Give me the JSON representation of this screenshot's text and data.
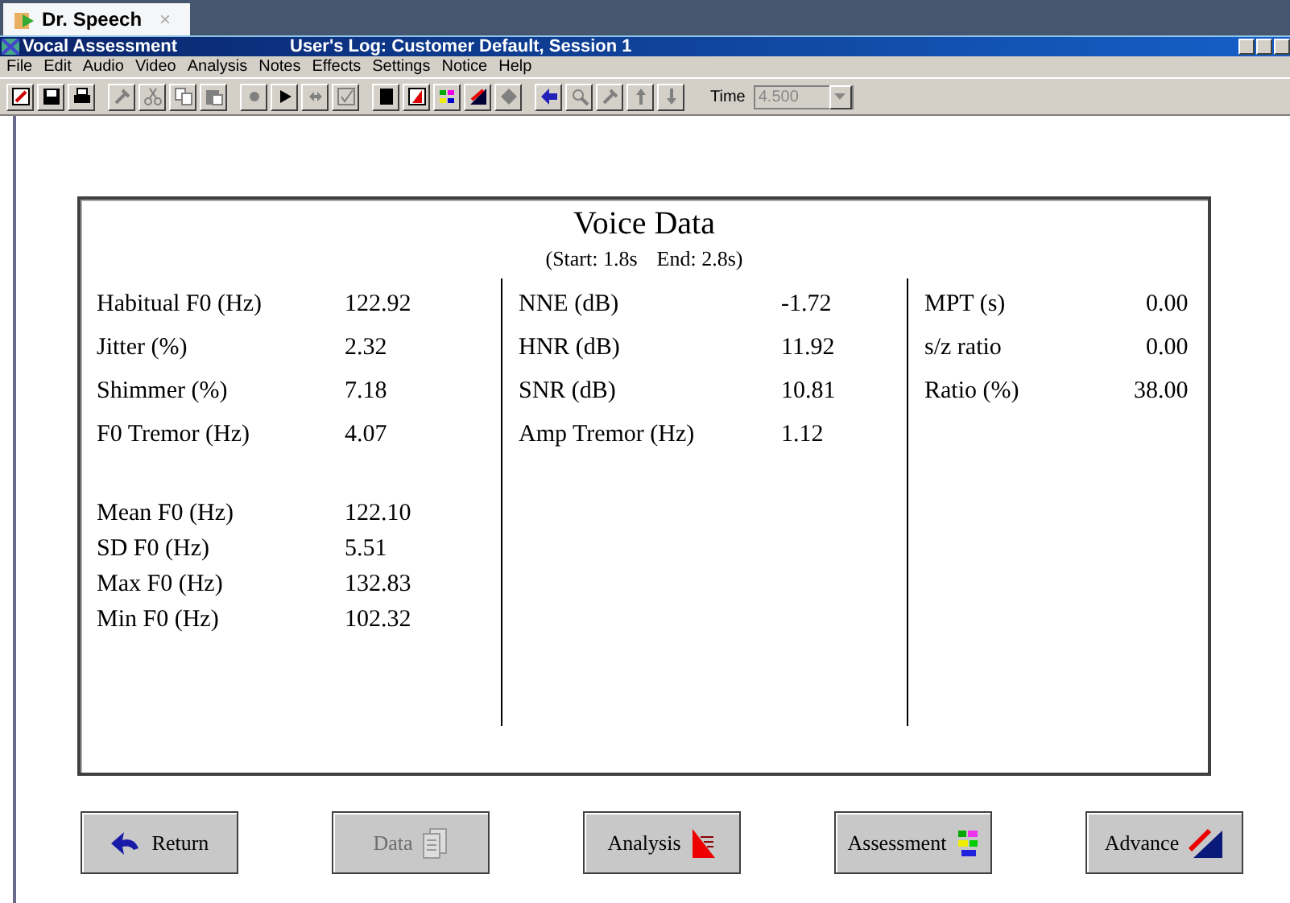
{
  "browser_tab": {
    "title": "Dr. Speech",
    "close": "×"
  },
  "window": {
    "title": "Vocal Assessment",
    "subtitle": "User's Log: Customer Default, Session 1"
  },
  "menu": [
    "File",
    "Edit",
    "Audio",
    "Video",
    "Analysis",
    "Notes",
    "Effects",
    "Settings",
    "Notice",
    "Help"
  ],
  "toolbar": [
    {
      "kind": "edit",
      "disabled": false
    },
    {
      "kind": "save",
      "disabled": false
    },
    {
      "kind": "print",
      "disabled": false
    },
    {
      "kind": "tool",
      "disabled": true
    },
    {
      "kind": "cut",
      "disabled": true
    },
    {
      "kind": "copy",
      "disabled": true
    },
    {
      "kind": "paste",
      "disabled": true
    },
    {
      "kind": "record",
      "disabled": true
    },
    {
      "kind": "play",
      "disabled": false
    },
    {
      "kind": "loop",
      "disabled": true
    },
    {
      "kind": "check",
      "disabled": true
    },
    {
      "kind": "stop",
      "disabled": false
    },
    {
      "kind": "chart",
      "disabled": false
    },
    {
      "kind": "grid",
      "disabled": false
    },
    {
      "kind": "trend",
      "disabled": false
    },
    {
      "kind": "diamond",
      "disabled": true
    },
    {
      "kind": "back",
      "disabled": false
    },
    {
      "kind": "search",
      "disabled": true
    },
    {
      "kind": "tool",
      "disabled": true
    },
    {
      "kind": "up",
      "disabled": true
    },
    {
      "kind": "down",
      "disabled": true
    }
  ],
  "time": {
    "label": "Time",
    "value": "4.500",
    "disabled": true
  },
  "panel": {
    "title": "Voice Data",
    "range_start": "(Start: 1.8s",
    "range_end": "End: 2.8s)",
    "columns": [
      {
        "groups": [
          [
            {
              "label": "Habitual F0 (Hz)",
              "value": "122.92"
            },
            {
              "label": "Jitter (%)",
              "value": "2.32"
            },
            {
              "label": "Shimmer (%)",
              "value": "7.18"
            },
            {
              "label": "F0 Tremor (Hz)",
              "value": "4.07"
            }
          ],
          [
            {
              "label": "Mean F0 (Hz)",
              "value": "122.10"
            },
            {
              "label": "SD F0 (Hz)",
              "value": "5.51"
            },
            {
              "label": "Max F0 (Hz)",
              "value": "132.83"
            },
            {
              "label": "Min F0 (Hz)",
              "value": "102.32"
            }
          ]
        ]
      },
      {
        "groups": [
          [
            {
              "label": "NNE (dB)",
              "value": "-1.72"
            },
            {
              "label": "HNR (dB)",
              "value": "11.92"
            },
            {
              "label": "SNR (dB)",
              "value": "10.81"
            },
            {
              "label": "Amp Tremor (Hz)",
              "value": "1.12"
            }
          ]
        ]
      },
      {
        "groups": [
          [
            {
              "label": "MPT (s)",
              "value": "0.00"
            },
            {
              "label": "s/z ratio",
              "value": "0.00"
            },
            {
              "label": "Ratio (%)",
              "value": "38.00"
            }
          ]
        ]
      }
    ]
  },
  "buttons": [
    {
      "label": "Return",
      "kind": "return",
      "disabled": false
    },
    {
      "label": "Data",
      "kind": "data",
      "disabled": true
    },
    {
      "label": "Analysis",
      "kind": "analysis",
      "disabled": false
    },
    {
      "label": "Assessment",
      "kind": "assessment",
      "disabled": false
    },
    {
      "label": "Advance",
      "kind": "advance",
      "disabled": false
    }
  ]
}
